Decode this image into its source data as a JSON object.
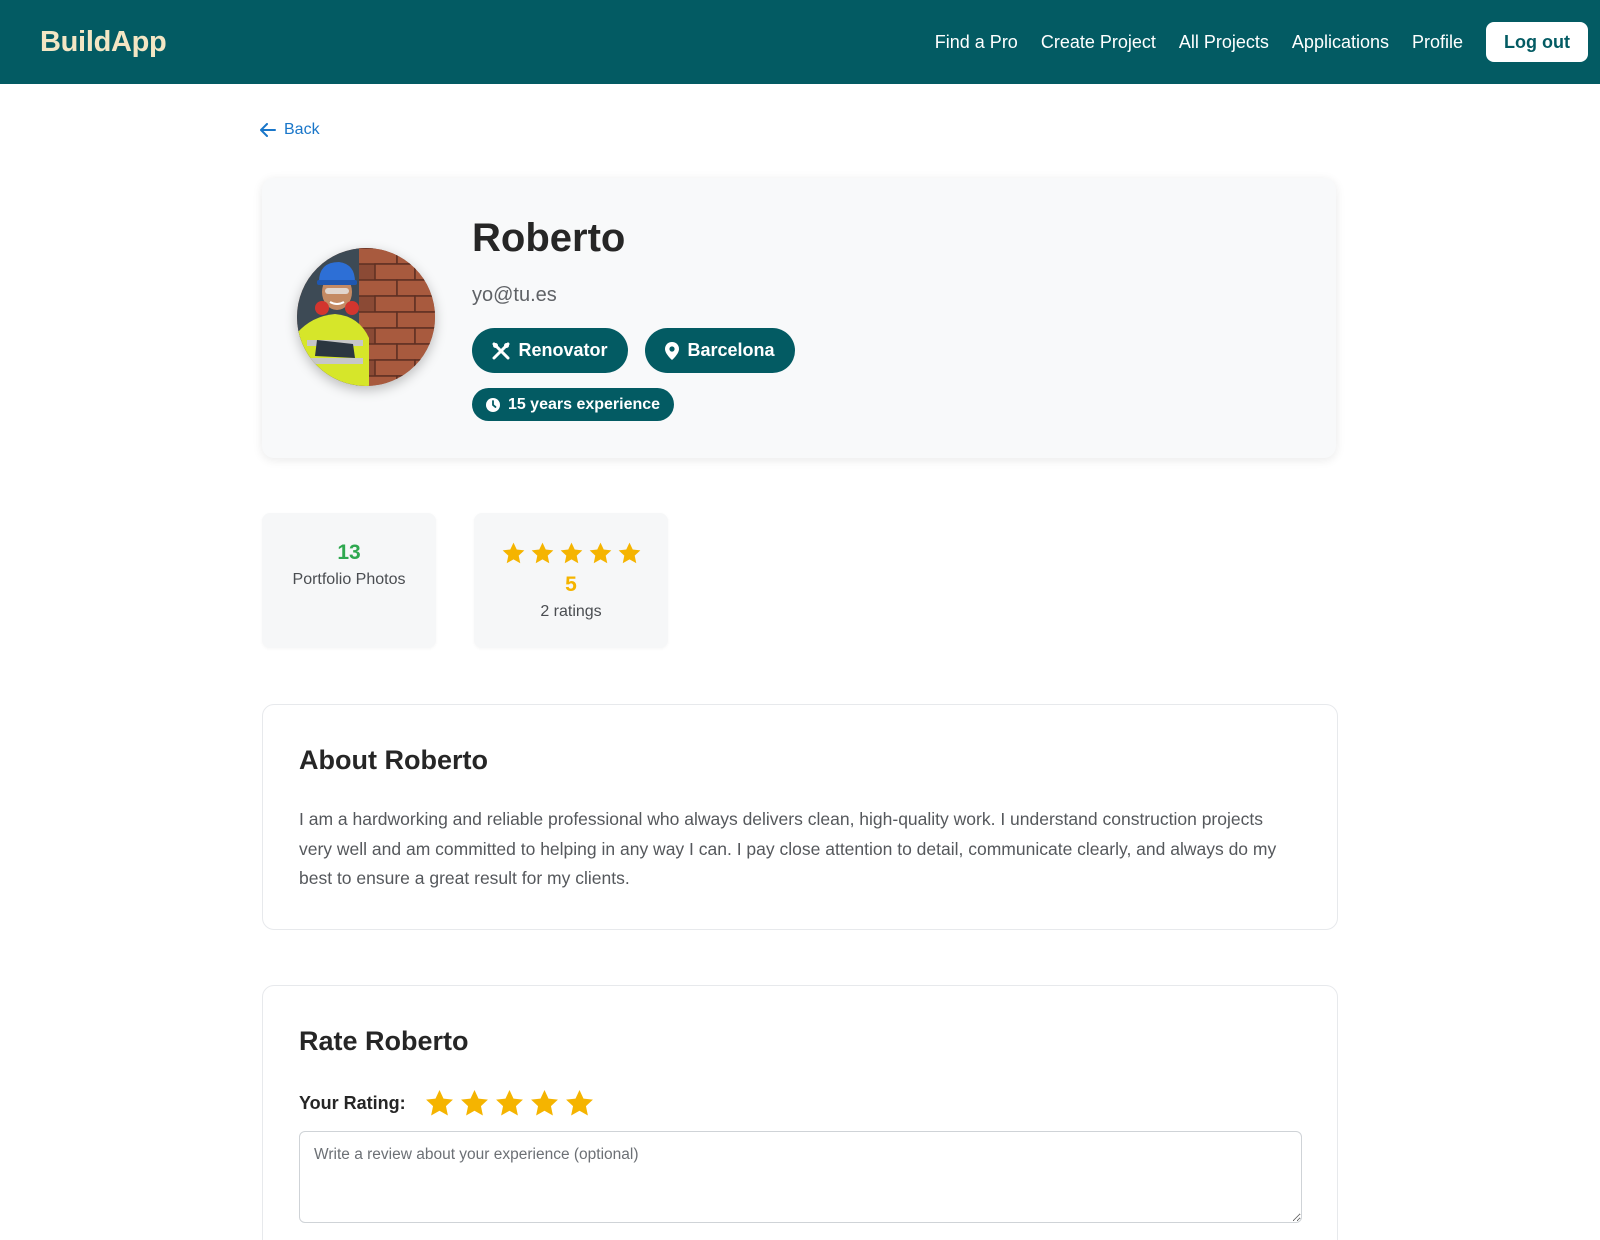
{
  "header": {
    "brand": "BuildApp",
    "nav": [
      "Find a Pro",
      "Create Project",
      "All Projects",
      "Applications",
      "Profile"
    ],
    "logout_label": "Log out"
  },
  "back_label": "Back",
  "profile": {
    "name": "Roberto",
    "email": "yo@tu.es",
    "role": "Renovator",
    "city": "Barcelona",
    "experience": "15 years experience"
  },
  "stats": {
    "portfolio_count": "13",
    "portfolio_label": "Portfolio Photos",
    "rating_stars": 5,
    "rating_value": "5",
    "rating_count_label": "2 ratings"
  },
  "about": {
    "title": "About Roberto",
    "text": "I am a hardworking and reliable professional who always delivers clean, high-quality work. I understand construction projects very well and am committed to helping in any way I can. I pay close attention to detail, communicate clearly, and always do my best to ensure a great result for my clients."
  },
  "rate": {
    "title": "Rate Roberto",
    "your_rating_label": "Your Rating:",
    "review_placeholder": "Write a review about your experience (optional)"
  },
  "colors": {
    "primary": "#035b63",
    "brand_text": "#f3e6c4",
    "star": "#f5b400",
    "link": "#1976c9",
    "green": "#2ea84f"
  },
  "icons": {
    "back": "arrow-left-icon",
    "role": "tools-icon",
    "city": "map-pin-icon",
    "experience": "clock-icon",
    "rating": "star-icon"
  }
}
